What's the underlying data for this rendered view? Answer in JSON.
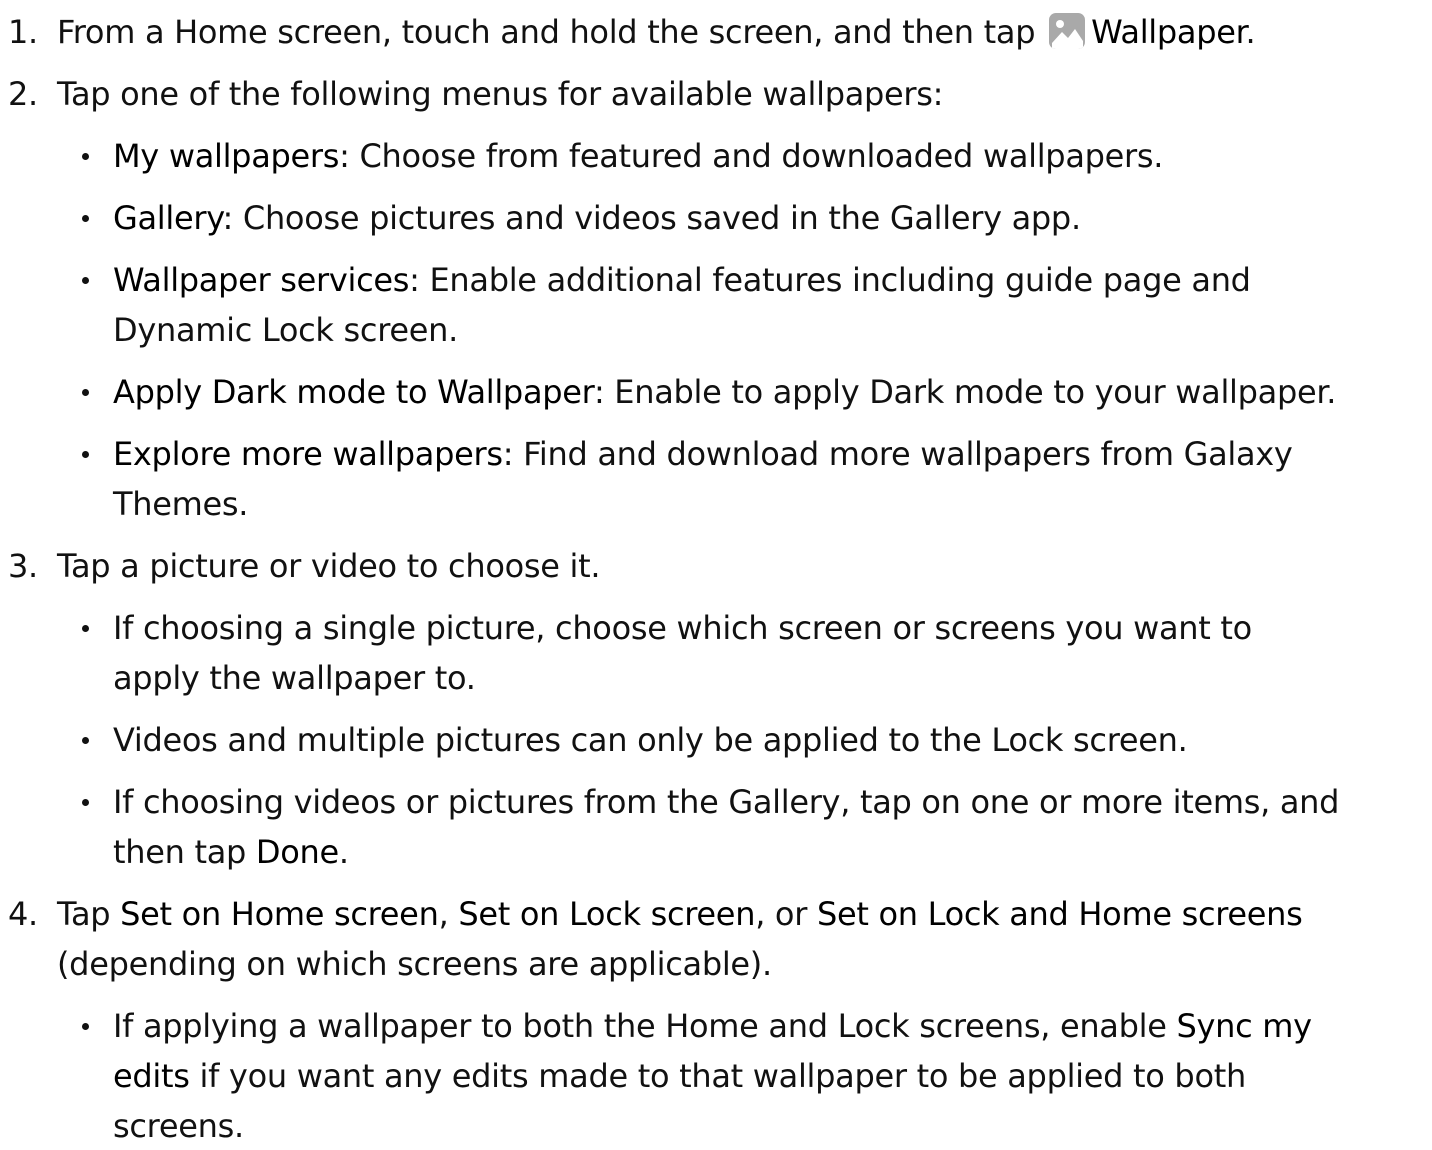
{
  "steps": [
    {
      "number": "1.",
      "before": "From a Home screen, touch and hold the screen, and then tap ",
      "icon": "wallpaper-icon",
      "term": "Wallpaper",
      "after": "."
    },
    {
      "number": "2.",
      "text": "Tap one of the following menus for available wallpapers:",
      "bullets": [
        {
          "term": "My wallpapers",
          "desc": ": Choose from featured and downloaded wallpapers."
        },
        {
          "term": "Gallery",
          "desc": ": Choose pictures and videos saved in the Gallery app."
        },
        {
          "term": "Wallpaper services",
          "desc": ": Enable additional features including guide page and",
          "desc2": "Dynamic Lock screen."
        },
        {
          "term": "Apply Dark mode to Wallpaper",
          "desc": ": Enable to apply Dark mode to your wallpaper."
        },
        {
          "term": "Explore more wallpapers",
          "desc": ": Find and download more wallpapers from Galaxy",
          "desc2": "Themes."
        }
      ]
    },
    {
      "number": "3.",
      "text": "Tap a picture or video to choose it.",
      "bullets": [
        {
          "line1": "If choosing a single picture, choose which screen or screens you want to",
          "line2": "apply the wallpaper to."
        },
        {
          "line1": "Videos and multiple pictures can only be applied to the Lock screen."
        },
        {
          "line1": "If choosing videos or pictures from the Gallery, tap on one or more items, and",
          "line2_before": "then tap ",
          "line2_term": "Done",
          "line2_after": "."
        }
      ]
    },
    {
      "number": "4.",
      "text_before": "Tap ",
      "term1": "Set on Home screen",
      "sep1": ", ",
      "term2": "Set on Lock screen",
      "sep2": ", or ",
      "term3": "Set on Lock and Home screens",
      "line2": "(depending on which screens are applicable).",
      "bullets": [
        {
          "line1_before": "If applying a wallpaper to both the Home and Lock screens, enable ",
          "line1_term": "Sync my",
          "line2_term": "edits",
          "line2_after": " if you want any edits made to that wallpaper to be applied to both",
          "line3": "screens."
        }
      ]
    }
  ]
}
